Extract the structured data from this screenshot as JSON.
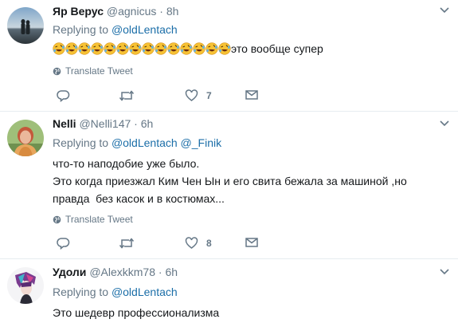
{
  "tweets": [
    {
      "name": "Яр Верус",
      "handle": "@agnicus",
      "sep": "·",
      "time": "8h",
      "replying_label": "Replying to",
      "replying_to": [
        "@oldLentach"
      ],
      "emoji": "rolling-on-the-floor-laughing",
      "emoji_count": 14,
      "text": "это вообще супер",
      "translate": "Translate Tweet",
      "actions": {
        "reply": "",
        "retweet": "",
        "like": "7"
      }
    },
    {
      "name": "Nelli",
      "handle": "@Nelli147",
      "sep": "·",
      "time": "6h",
      "replying_label": "Replying to",
      "replying_to": [
        "@oldLentach",
        "@_Finik"
      ],
      "lines": [
        "что-то наподобие уже было.",
        "Это когда приезжал Ким Чен Ын и его свита бежала за машиной ,но",
        "правда  без касок и в костюмах..."
      ],
      "translate": "Translate Tweet",
      "actions": {
        "reply": "",
        "retweet": "",
        "like": "8"
      }
    },
    {
      "name": "Удоли",
      "handle": "@Alexkkm78",
      "sep": "·",
      "time": "6h",
      "replying_label": "Replying to",
      "replying_to": [
        "@oldLentach"
      ],
      "text": "Это шедевр профессионализма"
    }
  ],
  "icons": {
    "caret": "chevron-down-icon",
    "globe": "globe-icon",
    "reply": "reply-icon",
    "retweet": "retweet-icon",
    "like": "heart-icon",
    "dm": "envelope-icon"
  },
  "colors": {
    "link": "#1b6ea8",
    "muted": "#657786",
    "divider": "#e6ecf0"
  }
}
